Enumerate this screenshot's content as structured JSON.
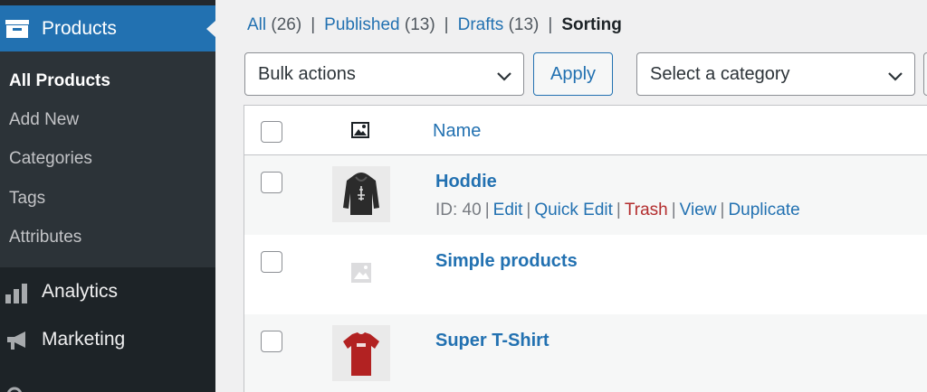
{
  "sidebar": {
    "active_menu": {
      "label": "Products",
      "icon": "archive-box-icon"
    },
    "submenu": [
      {
        "label": "All Products",
        "current": true
      },
      {
        "label": "Add New",
        "current": false
      },
      {
        "label": "Categories",
        "current": false
      },
      {
        "label": "Tags",
        "current": false
      },
      {
        "label": "Attributes",
        "current": false
      }
    ],
    "menus": [
      {
        "label": "Analytics",
        "icon": "bar-chart-icon"
      },
      {
        "label": "Marketing",
        "icon": "megaphone-icon"
      }
    ]
  },
  "filters": {
    "all": {
      "label": "All",
      "count": "(26)"
    },
    "published": {
      "label": "Published",
      "count": "(13)"
    },
    "drafts": {
      "label": "Drafts",
      "count": "(13)"
    },
    "sorting": {
      "label": "Sorting"
    },
    "separator": "|"
  },
  "toolbar": {
    "bulk_actions": "Bulk actions",
    "apply": "Apply",
    "category": "Select a category"
  },
  "table": {
    "columns": {
      "name": "Name"
    },
    "rows": [
      {
        "title": "Hoddie",
        "thumbnail": "hoodie-image",
        "actions": {
          "id": "ID: 40",
          "edit": "Edit",
          "quick_edit": "Quick Edit",
          "trash": "Trash",
          "view": "View",
          "duplicate": "Duplicate",
          "separator": "|"
        }
      },
      {
        "title": "Simple products",
        "thumbnail": "placeholder-image-icon"
      },
      {
        "title": "Super T-Shirt",
        "thumbnail": "tshirt-image"
      }
    ]
  },
  "colors": {
    "sidebar_bg": "#1d2327",
    "sidebar_sub_bg": "#2c3338",
    "accent": "#2271b1",
    "trash": "#b32d2e"
  }
}
